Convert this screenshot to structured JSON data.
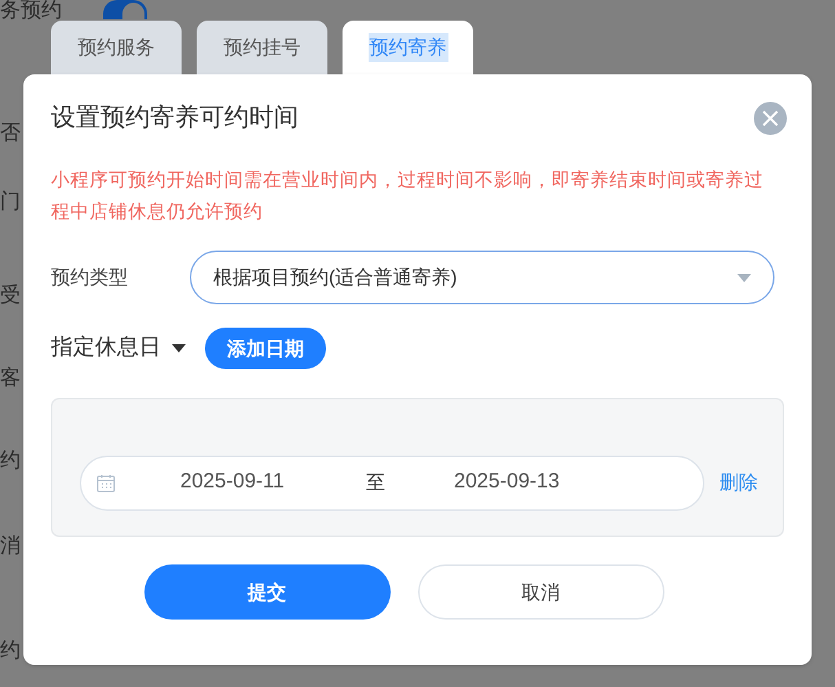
{
  "background": {
    "heading": "务预约",
    "toggle": {
      "on": true
    },
    "side_labels": [
      "否",
      "门",
      "受",
      "客",
      "约",
      "消",
      "约"
    ]
  },
  "tabs": [
    {
      "label": "预约服务",
      "selected": false
    },
    {
      "label": "预约挂号",
      "selected": false
    },
    {
      "label": "预约寄养",
      "selected": true
    }
  ],
  "dialog": {
    "title": "设置预约寄养可约时间",
    "notice": "小程序可预约开始时间需在营业时间内，过程时间不影响，即寄养结束时间或寄养过程中店铺休息仍允许预约",
    "type_label": "预约类型",
    "type_value": "根据项目预约(适合普通寄养)",
    "rest_label": "指定休息日",
    "add_button": "添加日期",
    "ranges": [
      {
        "start": "2025-09-11",
        "separator": "至",
        "end": "2025-09-13",
        "delete": "删除"
      }
    ],
    "buttons": [
      {
        "label": "提交",
        "kind": "primary"
      },
      {
        "label": "取消",
        "kind": "secondary"
      }
    ]
  }
}
